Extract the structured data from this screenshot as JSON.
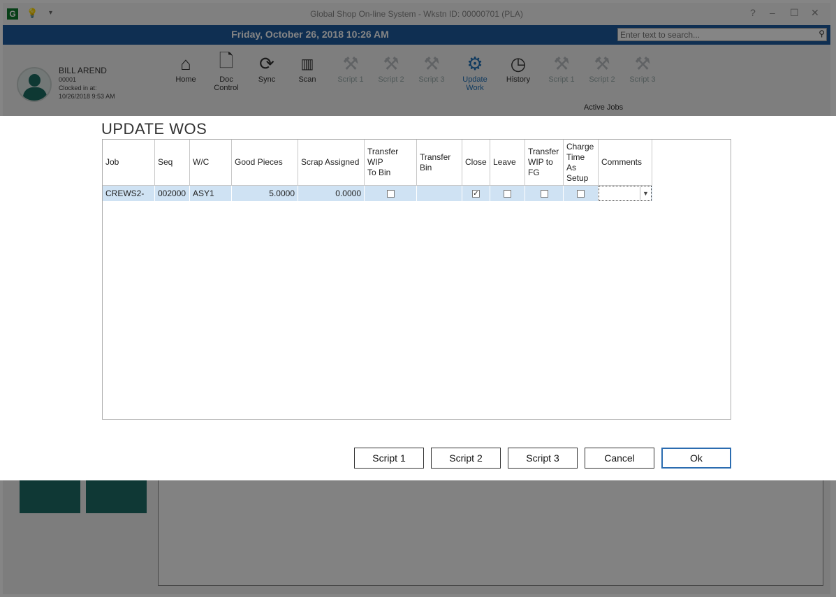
{
  "app": {
    "title": "Global Shop On-line System - Wkstn ID: 00000701 (PLA)",
    "app_icon_letter": "G",
    "date_time": "Friday, October 26, 2018 10:26 AM",
    "search_placeholder": "Enter text to search...",
    "window_controls": {
      "help": "?",
      "minimize": "–",
      "maximize": "☐",
      "close": "✕"
    }
  },
  "user": {
    "name": "BILL AREND",
    "id": "00001",
    "clocked_label": "Clocked in at:",
    "clocked_time": "10/26/2018 9:53 AM"
  },
  "ribbon": {
    "home": "Home",
    "doc_control_1": "Doc",
    "doc_control_2": "Control",
    "sync": "Sync",
    "scan": "Scan",
    "script1": "Script 1",
    "script2": "Script 2",
    "script3": "Script 3",
    "update_work_1": "Update",
    "update_work_2": "Work",
    "history": "History",
    "active_script1": "Script 1",
    "active_script2": "Script 2",
    "active_script3": "Script 3",
    "active_jobs_label": "Active Jobs"
  },
  "dialog": {
    "title": "UPDATE WOS",
    "columns": {
      "job": "Job",
      "seq": "Seq",
      "wc": "W/C",
      "good_pieces": "Good Pieces",
      "scrap_assigned": "Scrap Assigned",
      "transfer_wip_to_bin_1": "Transfer WIP",
      "transfer_wip_to_bin_2": "To Bin",
      "transfer_bin_1": "Transfer",
      "transfer_bin_2": "Bin",
      "close": "Close",
      "leave": "Leave",
      "transfer_wip_fg_1": "Transfer",
      "transfer_wip_fg_2": "WIP to",
      "transfer_wip_fg_3": "FG",
      "charge_setup_1": "Charge",
      "charge_setup_2": "Time",
      "charge_setup_3": "As",
      "charge_setup_4": "Setup",
      "comments": "Comments"
    },
    "row": {
      "job": "CREWS2-",
      "seq": "002000",
      "wc": "ASY1",
      "good_pieces": "5.0000",
      "scrap_assigned": "0.0000",
      "transfer_wip_to_bin": false,
      "transfer_bin": "",
      "close": true,
      "leave": false,
      "transfer_wip_fg": false,
      "charge_setup": false,
      "comments": ""
    },
    "buttons": {
      "script1": "Script 1",
      "script2": "Script 2",
      "script3": "Script 3",
      "cancel": "Cancel",
      "ok": "Ok"
    }
  },
  "colors": {
    "date_bar": "#1d5a9e",
    "row_highlight": "#cfe2f3",
    "tile": "#1d6b67",
    "ok_border": "#2b6cb0"
  }
}
